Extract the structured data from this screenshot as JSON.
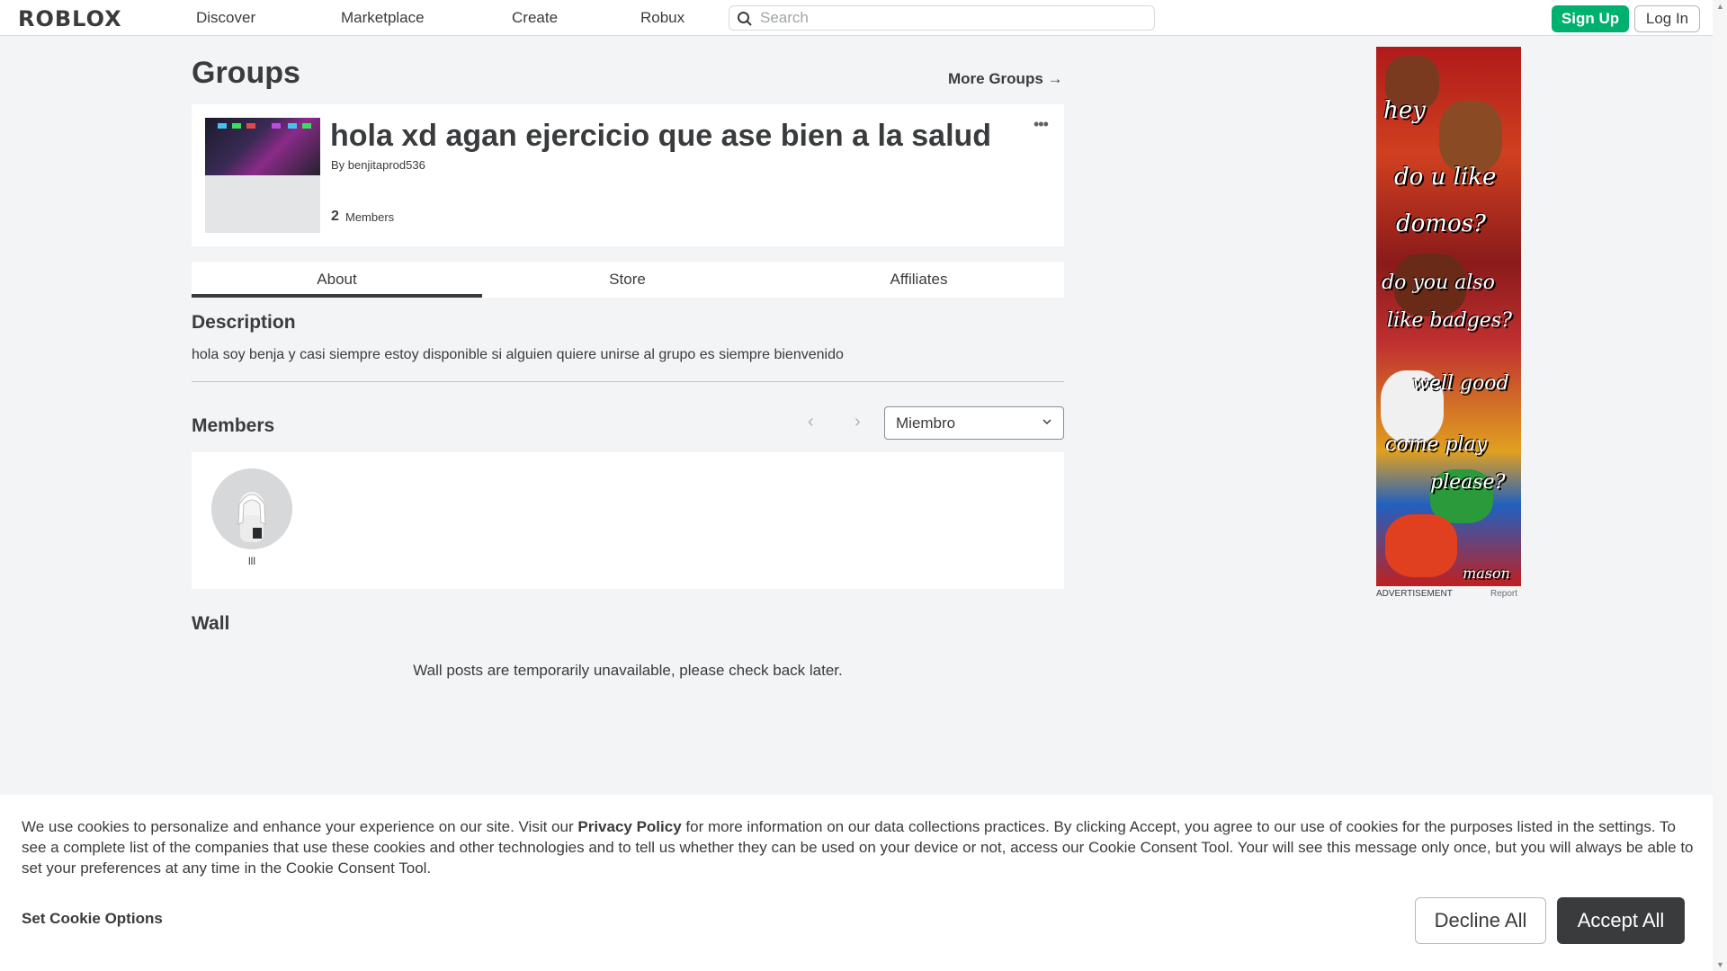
{
  "nav": {
    "logo": "ROBLOX",
    "links": [
      "Discover",
      "Marketplace",
      "Create",
      "Robux"
    ],
    "search_placeholder": "Search",
    "signup": "Sign Up",
    "login": "Log In"
  },
  "page": {
    "title": "Groups",
    "more_groups": "More Groups →"
  },
  "group": {
    "name": "hola xd agan ejercicio que ase bien a la salud",
    "by_prefix": "By",
    "owner": "benjitaprod536",
    "member_count": "2",
    "member_label": "Members",
    "more": "•••"
  },
  "tabs": [
    "About",
    "Store",
    "Affiliates"
  ],
  "description": {
    "title": "Description",
    "text": "hola soy benja y casi siempre estoy disponible si alguien quiere unirse al grupo es siempre bienvenido"
  },
  "members": {
    "title": "Members",
    "prev": "‹",
    "next": "›",
    "role": "Miembro",
    "list": [
      {
        "name": "lll"
      }
    ]
  },
  "wall": {
    "title": "Wall",
    "message": "Wall posts are temporarily unavailable, please check back later."
  },
  "ad": {
    "lines": [
      "hey",
      "do u like",
      "domos?",
      "do you also",
      "like badges?",
      "well good",
      "come play",
      "please?",
      "mason"
    ],
    "label": "ADVERTISEMENT",
    "report": "Report"
  },
  "cookie": {
    "text_before": "We use cookies to personalize and enhance your experience on our site. Visit our ",
    "privacy_link": "Privacy Policy",
    "text_after": " for more information on our data collections practices. By clicking Accept, you agree to our use of cookies for the purposes listed in the settings. To see a complete list of the companies that use these cookies and other technologies and to tell us whether they can be used on your device or not, access our Cookie Consent Tool. Your will see this message only once, but you will always be able to set your preferences at any time in the Cookie Consent Tool.",
    "options": "Set Cookie Options",
    "decline": "Decline All",
    "accept": "Accept All"
  },
  "colors": {
    "signup_green": "#00b06f",
    "accept_dark": "#393b3d",
    "background": "#f2f4f5"
  }
}
